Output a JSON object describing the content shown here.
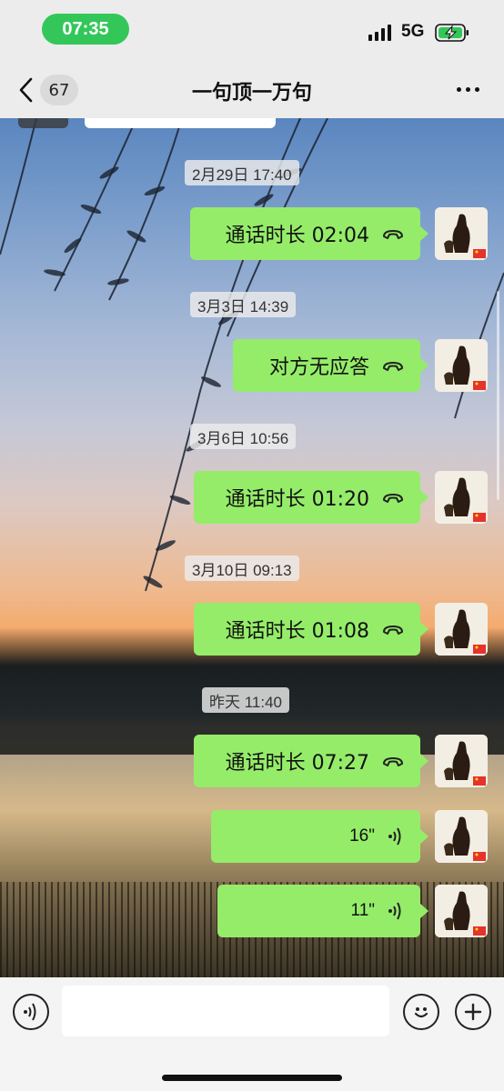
{
  "status_bar": {
    "time": "07:35",
    "network": "5G"
  },
  "nav": {
    "unread_count": "67",
    "title": "一句顶一万句"
  },
  "messages": [
    {
      "timestamp": "2月29日 17:40",
      "text": "通话时长 02:04",
      "kind": "call"
    },
    {
      "timestamp": "3月3日 14:39",
      "text": "对方无应答",
      "kind": "call"
    },
    {
      "timestamp": "3月6日 10:56",
      "text": "通话时长 01:20",
      "kind": "call"
    },
    {
      "timestamp": "3月10日 09:13",
      "text": "通话时长 01:08",
      "kind": "call"
    },
    {
      "timestamp": "昨天 11:40",
      "text": "通话时长 07:27",
      "kind": "call"
    },
    {
      "text": "16\"",
      "kind": "voice"
    },
    {
      "text": "11\"",
      "kind": "voice"
    }
  ],
  "icons": {
    "back": "chevron-left-icon",
    "more": "more-dots-icon",
    "call": "phone-hangup-icon",
    "voice": "voice-wave-icon",
    "voice_mode": "voice-mode-icon",
    "emoji": "emoji-icon",
    "add": "plus-icon"
  },
  "colors": {
    "bubble": "#95ec69",
    "time_pill": "#33c75a"
  }
}
